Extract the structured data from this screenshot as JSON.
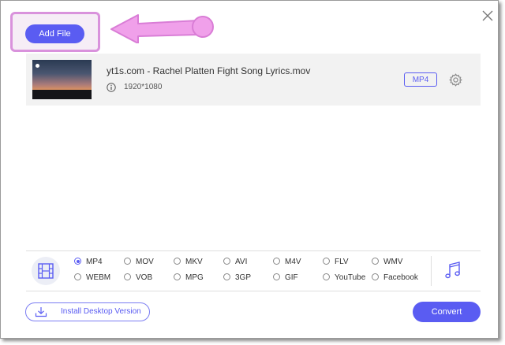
{
  "dialog": {
    "close_icon": "close-icon"
  },
  "toolbar": {
    "add_file_label": "Add File"
  },
  "file_list": [
    {
      "name": "yt1s.com - Rachel Platten Fight Song Lyrics.mov",
      "resolution": "1920*1080",
      "output_format": "MP4"
    }
  ],
  "formats": {
    "video_icon": "film-icon",
    "audio_icon": "music-note-icon",
    "selected": "MP4",
    "row1": [
      "MP4",
      "MOV",
      "MKV",
      "AVI",
      "M4V",
      "FLV",
      "WMV"
    ],
    "row2": [
      "WEBM",
      "VOB",
      "MPG",
      "3GP",
      "GIF",
      "YouTube",
      "Facebook"
    ]
  },
  "footer": {
    "install_label": "Install Desktop Version",
    "convert_label": "Convert"
  },
  "colors": {
    "accent": "#5a5cf2",
    "highlight": "#d992dc"
  }
}
